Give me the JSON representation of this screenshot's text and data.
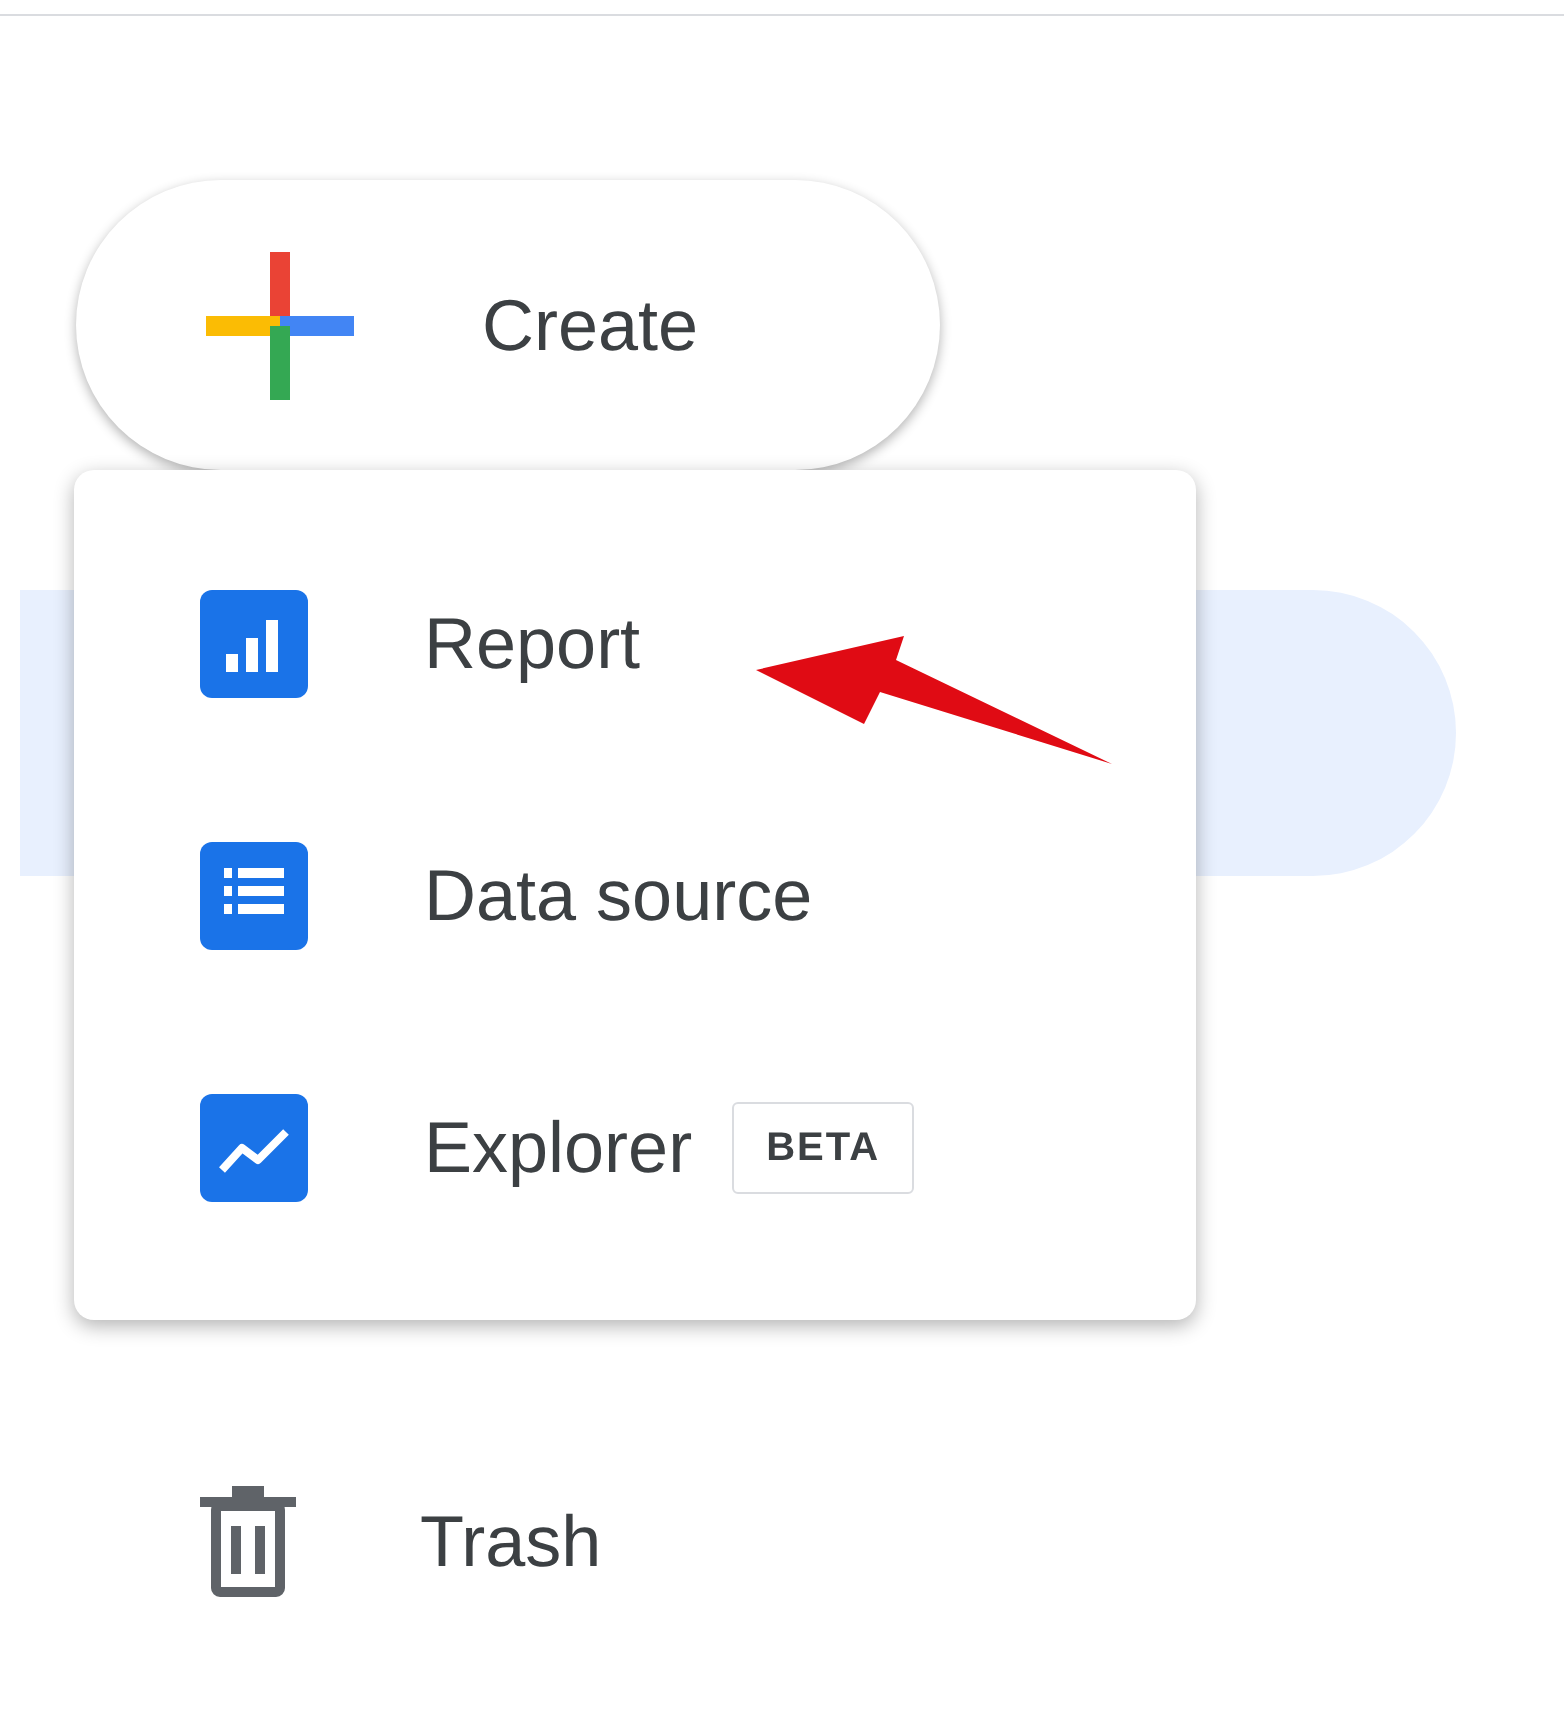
{
  "create_button": {
    "label": "Create"
  },
  "sidebar": {
    "items": [
      {
        "selected": true
      },
      {
        "label": "Trash",
        "kind": "trash",
        "selected": false
      }
    ]
  },
  "menu": {
    "items": [
      {
        "label": "Report",
        "kind": "report"
      },
      {
        "label": "Data source",
        "kind": "data_source"
      },
      {
        "label": "Explorer",
        "kind": "explorer",
        "badge": "BETA"
      }
    ]
  }
}
